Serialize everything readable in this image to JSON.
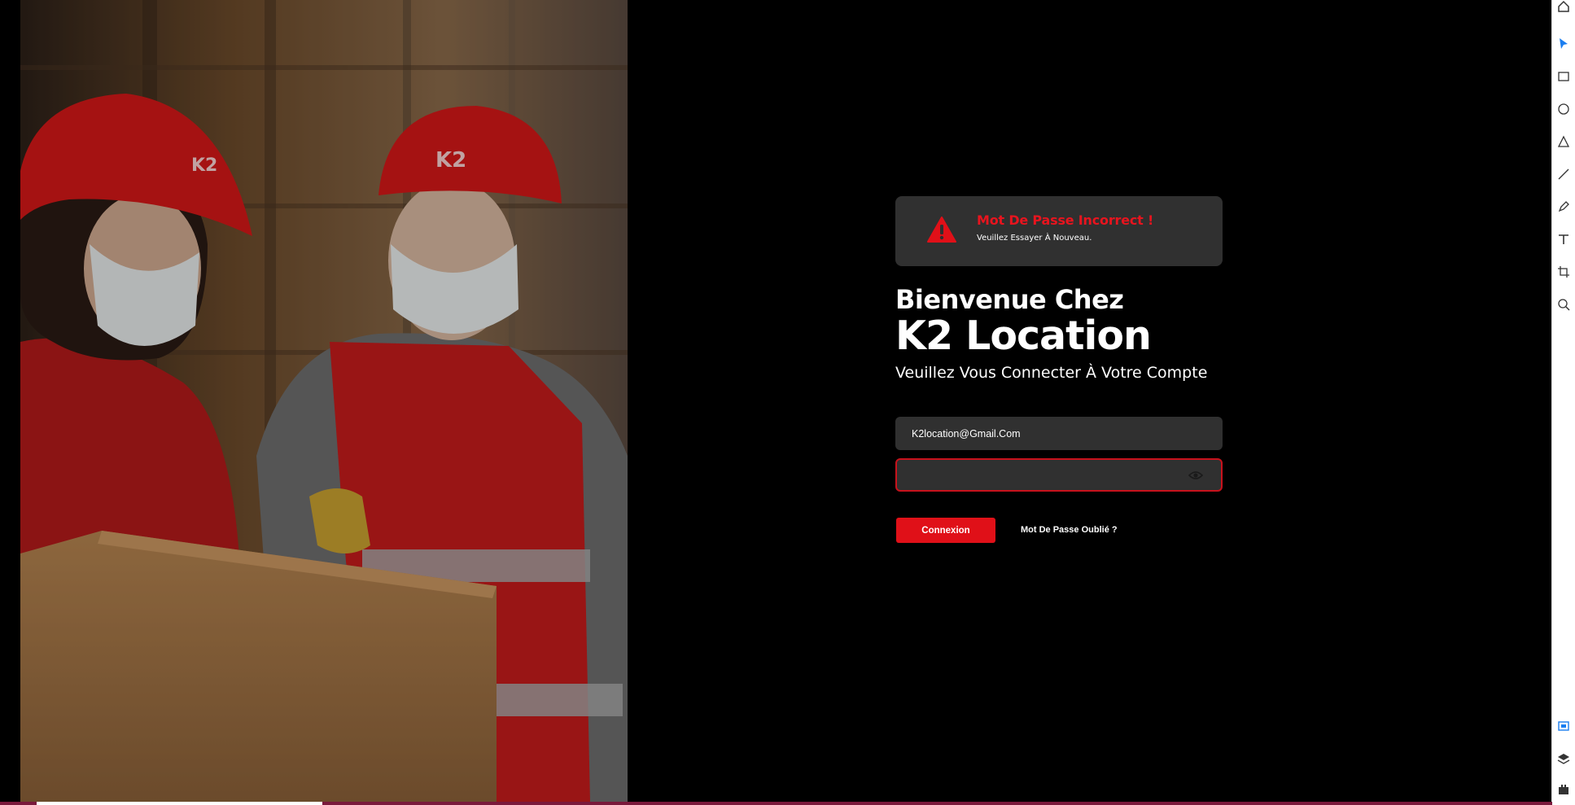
{
  "alert": {
    "title": "Mot De Passe Incorrect !",
    "message": "Veuillez Essayer À Nouveau.",
    "icon": "warning-triangle-icon",
    "color": "#e8141e"
  },
  "hero": {
    "welcome": "Bienvenue Chez",
    "brand": "K2 Location",
    "subtitle": "Veuillez Vous Connecter À Votre Compte"
  },
  "form": {
    "email_value": "K2location@Gmail.Com",
    "password_value": "",
    "password_icon": "eye-icon",
    "submit_label": "Connexion",
    "forgot_label": "Mot De Passe Oublié  ?"
  },
  "photo": {
    "helmet_logo": "K2"
  },
  "tool_strip": {
    "icons": [
      "home-icon",
      "pointer-icon",
      "rectangle-icon",
      "ellipse-icon",
      "triangle-icon",
      "line-icon",
      "pen-icon",
      "text-icon",
      "crop-icon",
      "zoom-icon",
      "frame-icon",
      "layers-icon",
      "plugins-icon"
    ]
  },
  "bottom_bar": {
    "progress_percent": 19
  },
  "colors": {
    "background": "#000000",
    "panel": "#303030",
    "accent": "#e01018",
    "error_border": "#c8121c"
  }
}
